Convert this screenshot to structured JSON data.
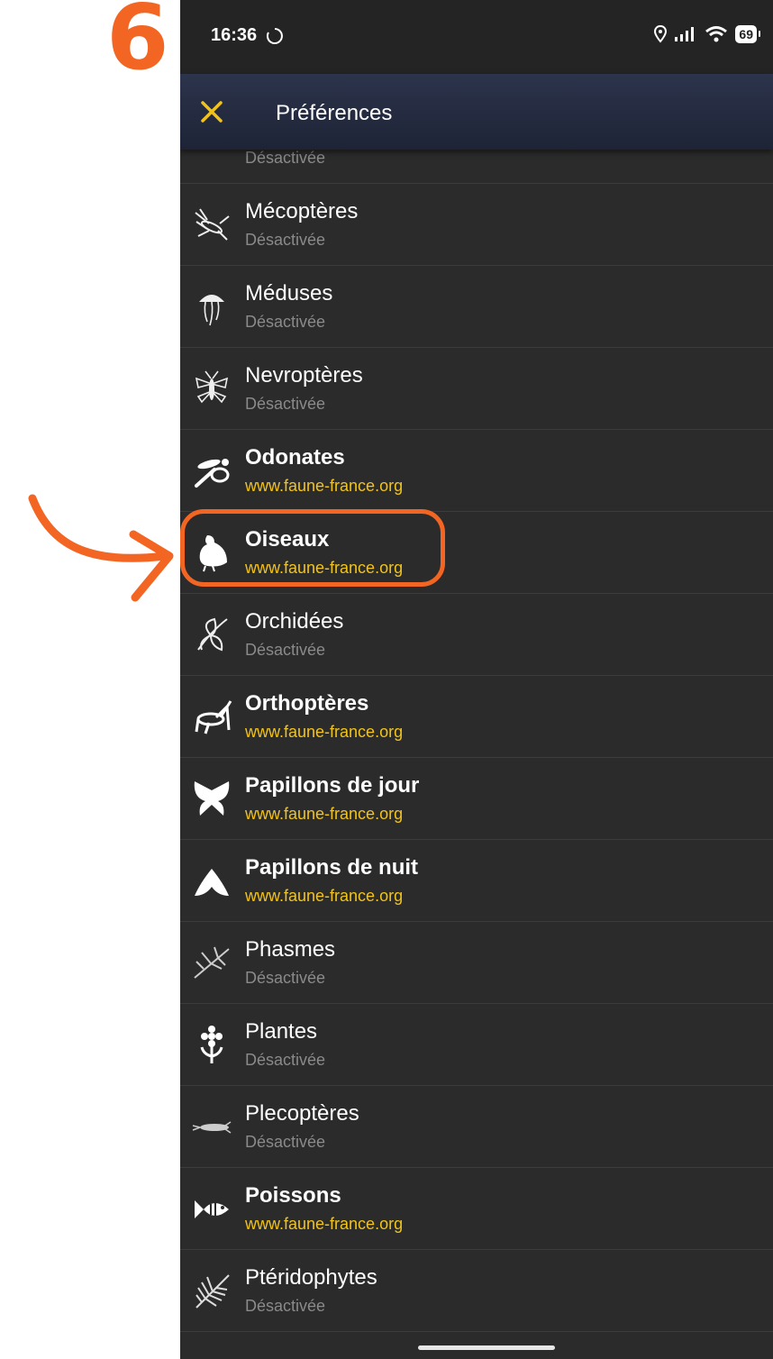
{
  "step_number": "6",
  "status_bar": {
    "time": "16:36",
    "battery": "69"
  },
  "app_bar": {
    "title": "Préférences",
    "close_icon": "close-icon"
  },
  "colors": {
    "accent": "#f2c318",
    "annotation": "#f26522",
    "background": "#2b2b2b"
  },
  "list": [
    {
      "title": "",
      "subtitle": "Désactivée",
      "active": false,
      "icon": "partial-icon"
    },
    {
      "title": "Mécoptères",
      "subtitle": "Désactivée",
      "active": false,
      "icon": "scorpionfly-icon"
    },
    {
      "title": "Méduses",
      "subtitle": "Désactivée",
      "active": false,
      "icon": "jellyfish-icon"
    },
    {
      "title": "Nevroptères",
      "subtitle": "Désactivée",
      "active": false,
      "icon": "lacewing-icon"
    },
    {
      "title": "Odonates",
      "subtitle": "www.faune-france.org",
      "active": true,
      "icon": "dragonfly-icon"
    },
    {
      "title": "Oiseaux",
      "subtitle": "www.faune-france.org",
      "active": true,
      "icon": "bird-icon"
    },
    {
      "title": "Orchidées",
      "subtitle": "Désactivée",
      "active": false,
      "icon": "orchid-icon"
    },
    {
      "title": "Orthoptères",
      "subtitle": "www.faune-france.org",
      "active": true,
      "icon": "grasshopper-icon"
    },
    {
      "title": "Papillons de jour",
      "subtitle": "www.faune-france.org",
      "active": true,
      "icon": "butterfly-icon"
    },
    {
      "title": "Papillons de nuit",
      "subtitle": "www.faune-france.org",
      "active": true,
      "icon": "moth-icon"
    },
    {
      "title": "Phasmes",
      "subtitle": "Désactivée",
      "active": false,
      "icon": "stick-insect-icon"
    },
    {
      "title": "Plantes",
      "subtitle": "Désactivée",
      "active": false,
      "icon": "flower-icon"
    },
    {
      "title": "Plecoptères",
      "subtitle": "Désactivée",
      "active": false,
      "icon": "stonefly-icon"
    },
    {
      "title": "Poissons",
      "subtitle": "www.faune-france.org",
      "active": true,
      "icon": "fish-icon"
    },
    {
      "title": "Ptéridophytes",
      "subtitle": "Désactivée",
      "active": false,
      "icon": "fern-icon"
    }
  ]
}
